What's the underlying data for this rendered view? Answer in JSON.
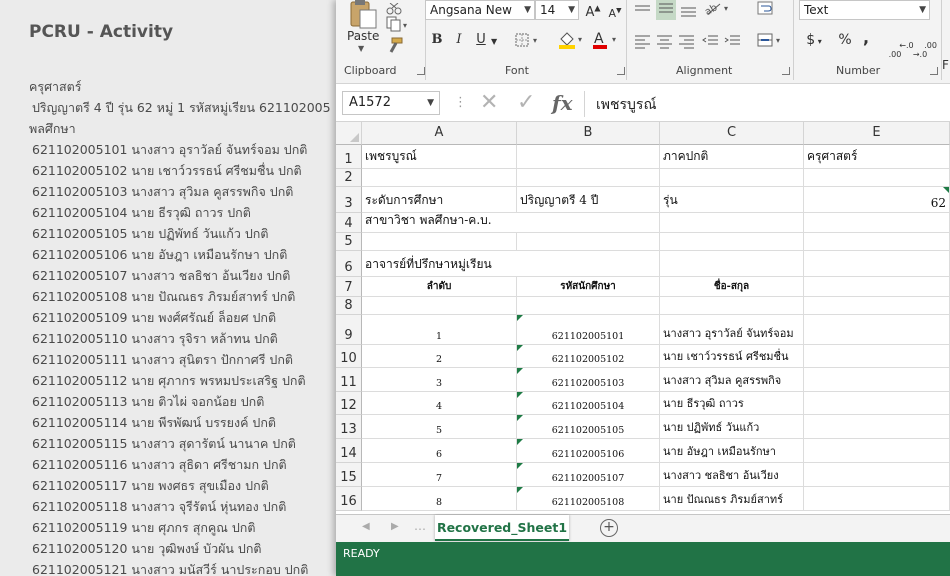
{
  "background_page": {
    "title": "PCRU - Activity",
    "lines": [
      {
        "text": "ครุศาสตร์",
        "indent": false
      },
      {
        "text": "ปริญญาตรี 4 ปี รุ่น  62 หมู่ 1 รหัสหมู่เรียน 621102005",
        "indent": true
      },
      {
        "text": "พลศึกษา",
        "indent": false
      },
      {
        "text": "621102005101 นางสาว อุราวัลย์ จันทร์จอม ปกติ",
        "indent": true
      },
      {
        "text": "621102005102 นาย เชาว์วรรธน์ ศรีชมชื่น ปกติ",
        "indent": true
      },
      {
        "text": "621102005103 นางสาว สุวิมล คูสรรพกิจ ปกติ",
        "indent": true
      },
      {
        "text": "621102005104 นาย ธีรวุฒิ ถาวร ปกติ",
        "indent": true
      },
      {
        "text": "621102005105 นาย ปฏิพัทธ์ วันแก้ว ปกติ",
        "indent": true
      },
      {
        "text": "621102005106 นาย อัษฎา เหมือนรักษา ปกติ",
        "indent": true
      },
      {
        "text": "621102005107 นางสาว ชลธิชา อ้นเวียง ปกติ",
        "indent": true
      },
      {
        "text": "621102005108 นาย ปัณณธร ภิรมย์สาทร์ ปกติ",
        "indent": true
      },
      {
        "text": "621102005109 นาย พงศ์ศรัณย์ ล็อยศ ปกติ",
        "indent": true
      },
      {
        "text": "621102005110 นางสาว รุจิรา หล้าทน ปกติ",
        "indent": true
      },
      {
        "text": "621102005111 นางสาว สุนิตรา ปักกาศรี ปกติ",
        "indent": true
      },
      {
        "text": "621102005112 นาย ศุภากร พรหมประเสริฐ ปกติ",
        "indent": true
      },
      {
        "text": "621102005113 นาย ติวไผ่ จอกน้อย ปกติ",
        "indent": true
      },
      {
        "text": "621102005114 นาย พีรพัฒน์ บรรยงค์ ปกติ",
        "indent": true
      },
      {
        "text": "621102005115 นางสาว สุดารัตน์ นานาค ปกติ",
        "indent": true
      },
      {
        "text": "621102005116 นางสาว สุธิดา ศรีชามก ปกติ",
        "indent": true
      },
      {
        "text": "621102005117 นาย พงศธร สุขเมือง ปกติ",
        "indent": true
      },
      {
        "text": "621102005118 นางสาว จุรีรัตน์ หุ่นทอง ปกติ",
        "indent": true
      },
      {
        "text": "621102005119 นาย ศุภกร สุกคูณ ปกติ",
        "indent": true
      },
      {
        "text": "621102005120 นาย วุฒิพงษ์ บัวผัน ปกติ",
        "indent": true
      },
      {
        "text": "621102005121 นางสาว มนัสวีร์ นาประกอบ ปกติ",
        "indent": true
      }
    ]
  },
  "ribbon": {
    "clipboard": {
      "label": "Clipboard",
      "paste": "Paste"
    },
    "font": {
      "label": "Font",
      "name": "Angsana New",
      "size": "14",
      "bold": "B",
      "italic": "I",
      "underline": "U"
    },
    "alignment": {
      "label": "Alignment"
    },
    "number": {
      "label": "Number",
      "format": "Text",
      "currency": "$",
      "percent": "%",
      "comma": ",",
      "inc_decimal": "←.0\n.00",
      "dec_decimal": ".00\n→.0"
    },
    "partial_group": "C\nF"
  },
  "formula_bar": {
    "name_box": "A1572",
    "content": "เพชรบูรณ์"
  },
  "columns": [
    "A",
    "B",
    "C",
    "E"
  ],
  "rows": [
    {
      "num": "1",
      "A": "เพชรบูรณ์",
      "B": "",
      "C": "ภาคปกติ",
      "E": "ครุศาสตร์"
    },
    {
      "num": "2",
      "A": "",
      "B": "",
      "C": "",
      "E": ""
    },
    {
      "num": "3",
      "A": "ระดับการศึกษา",
      "B": "ปริญญาตรี 4 ปี",
      "C": "รุ่น",
      "E": "62"
    },
    {
      "num": "4",
      "A": "สาขาวิชา พลศึกษา-ค.บ.",
      "B": "",
      "C": "",
      "E": ""
    },
    {
      "num": "5",
      "A": "",
      "B": "",
      "C": "",
      "E": ""
    },
    {
      "num": "6",
      "A": "อาจารย์ที่ปรึกษาหมู่เรียน",
      "B": "",
      "C": "",
      "E": ""
    },
    {
      "num": "7",
      "A": "ลำดับ",
      "B": "รหัสนักศึกษา",
      "C": "ชื่อ-สกุล",
      "E": ""
    },
    {
      "num": "8",
      "A": "",
      "B": "",
      "C": "",
      "E": ""
    },
    {
      "num": "9",
      "A": "1",
      "B": "621102005101",
      "C": "นางสาว อุราวัลย์  จันทร์จอม",
      "E": ""
    },
    {
      "num": "10",
      "A": "2",
      "B": "621102005102",
      "C": "นาย เชาว์วรรธน์  ศรีชมชื่น",
      "E": ""
    },
    {
      "num": "11",
      "A": "3",
      "B": "621102005103",
      "C": "นางสาว สุวิมล  คูสรรพกิจ",
      "E": ""
    },
    {
      "num": "12",
      "A": "4",
      "B": "621102005104",
      "C": "นาย ธีรวุฒิ  ถาวร",
      "E": ""
    },
    {
      "num": "13",
      "A": "5",
      "B": "621102005105",
      "C": "นาย ปฏิพัทธ์  วันแก้ว",
      "E": ""
    },
    {
      "num": "14",
      "A": "6",
      "B": "621102005106",
      "C": "นาย อัษฎา  เหมือนรักษา",
      "E": ""
    },
    {
      "num": "15",
      "A": "7",
      "B": "621102005107",
      "C": "นางสาว ชลธิชา  อ้นเวียง",
      "E": ""
    },
    {
      "num": "16",
      "A": "8",
      "B": "621102005108",
      "C": "นาย ปัณณธร  ภิรมย์สาทร์",
      "E": ""
    }
  ],
  "sheet_tabs": {
    "active": "Recovered_Sheet1"
  },
  "status": {
    "text": "READY"
  },
  "colors": {
    "excel_green": "#217346",
    "error_triangle": "#1e7b45"
  },
  "icons": [
    "paste-icon",
    "cut-icon",
    "copy-icon",
    "format-painter-icon",
    "grow-font-icon",
    "shrink-font-icon",
    "borders-icon",
    "fill-color-icon",
    "font-color-icon",
    "align-icon",
    "orientation-icon",
    "wrap-text-icon",
    "merge-icon",
    "cancel-icon",
    "enter-icon",
    "function-icon",
    "add-sheet-icon"
  ]
}
